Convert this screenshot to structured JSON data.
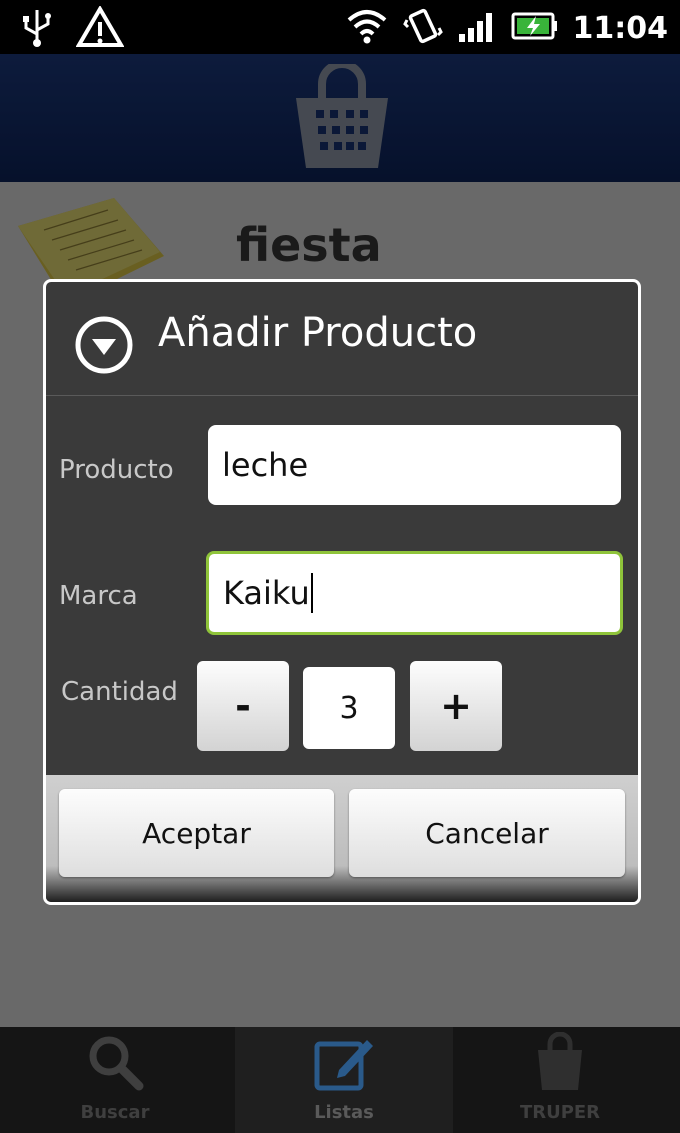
{
  "status_bar": {
    "time": "11:04",
    "icons": [
      "usb-icon",
      "warning-icon",
      "wifi-icon",
      "vibrate-icon",
      "signal-icon",
      "battery-charging-icon"
    ]
  },
  "app": {
    "header_icon": "shopping-basket-icon",
    "list_title": "fiesta"
  },
  "dialog": {
    "title": "Añadir Producto",
    "title_icon": "dropdown-circle-icon",
    "product_label": "Producto",
    "product_value": "leche",
    "brand_label": "Marca",
    "brand_value": "Kaiku",
    "quantity_label": "Cantidad",
    "decrement_label": "-",
    "quantity_value": "3",
    "increment_label": "+",
    "accept_label": "Aceptar",
    "cancel_label": "Cancelar",
    "focus_color": "#8fc43a"
  },
  "tabs": [
    {
      "label": "Buscar",
      "icon": "search-icon",
      "active": false
    },
    {
      "label": "Listas",
      "icon": "edit-list-icon",
      "active": true
    },
    {
      "label": "TRUPER",
      "icon": "shopping-bag-icon",
      "active": false
    }
  ]
}
